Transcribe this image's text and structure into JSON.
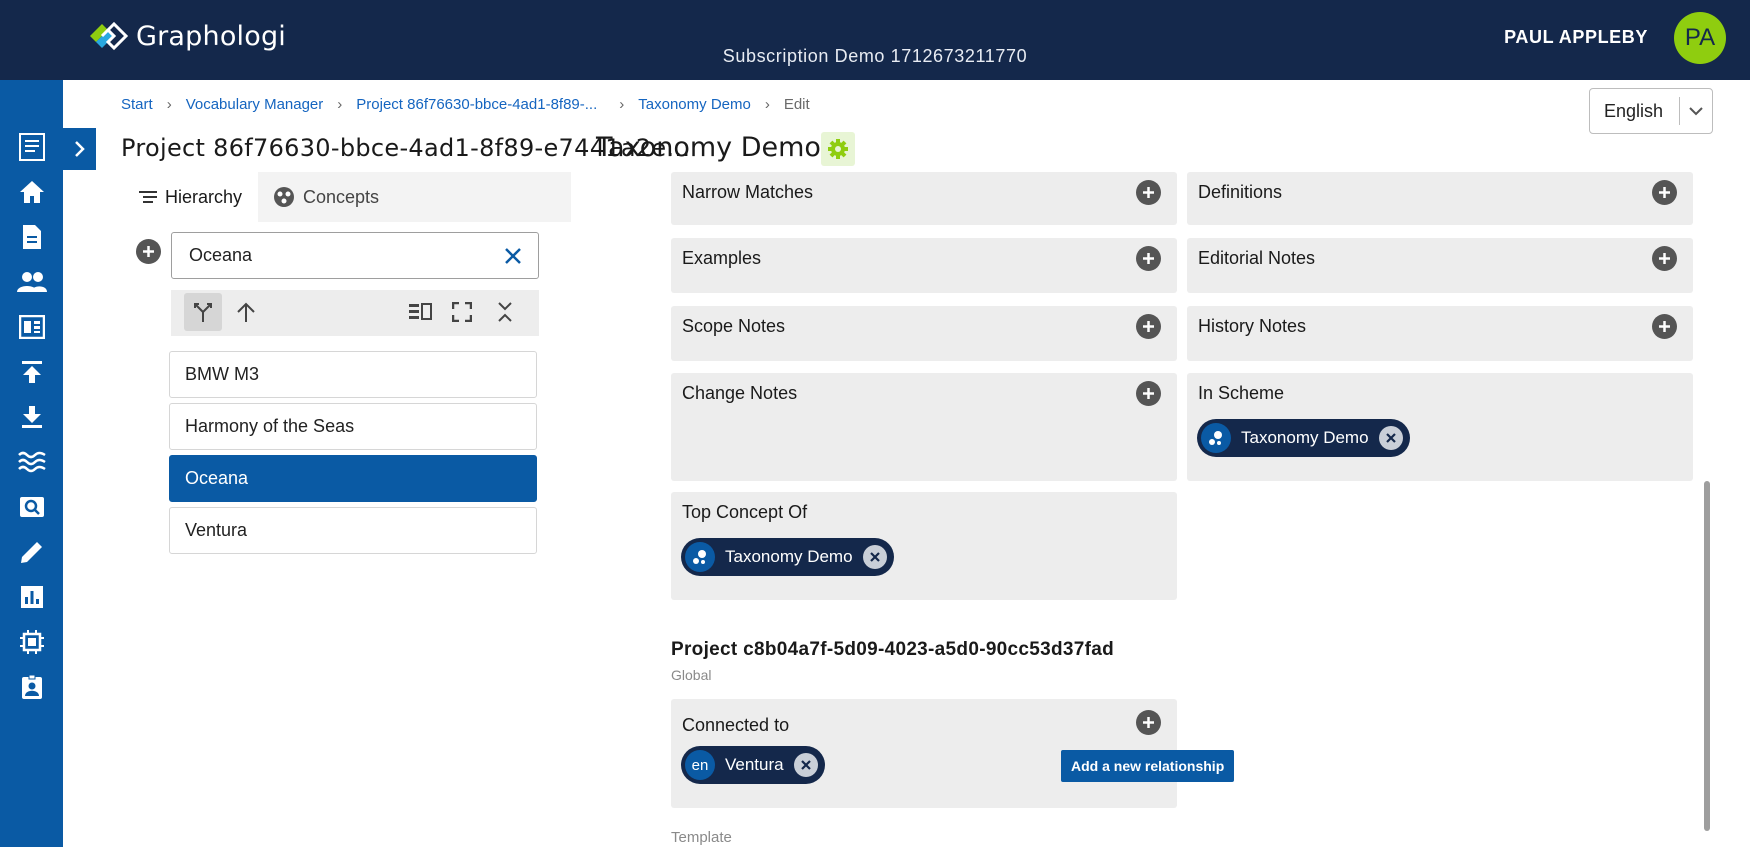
{
  "app": {
    "name": "Graphologi",
    "subscription": "Subscription Demo 1712673211770",
    "user_name": "PAUL APPLEBY",
    "user_initials": "PA"
  },
  "rail": {
    "icons": [
      "document-icon",
      "home-icon",
      "file-icon",
      "people-icon",
      "dashboard-icon",
      "upload-icon",
      "download-icon",
      "waves-icon",
      "search-icon",
      "edit-icon",
      "chart-icon",
      "chip-icon",
      "badge-icon"
    ]
  },
  "breadcrumb": {
    "items": [
      "Start",
      "Vocabulary Manager",
      "Project 86f76630-bbce-4ad1-8f89-...",
      "Taxonomy Demo"
    ],
    "current": "Edit"
  },
  "language": {
    "selected": "English"
  },
  "header": {
    "project_title": "Project 86f76630-bbce-4ad1-8f89-e7441a2e...",
    "taxonomy_title": "Taxonomy Demo"
  },
  "left_panel": {
    "tabs": [
      {
        "label": "Hierarchy",
        "icon": "list-icon"
      },
      {
        "label": "Concepts",
        "icon": "concepts-icon"
      }
    ],
    "search_value": "Oceana",
    "tree_items": [
      "BMW M3",
      "Harmony of the Seas",
      "Oceana",
      "Ventura"
    ],
    "selected_item": "Oceana"
  },
  "fields": {
    "narrow_matches": "Narrow Matches",
    "definitions": "Definitions",
    "examples": "Examples",
    "editorial_notes": "Editorial Notes",
    "scope_notes": "Scope Notes",
    "history_notes": "History Notes",
    "change_notes": "Change Notes",
    "in_scheme": "In Scheme",
    "in_scheme_chip": "Taxonomy Demo",
    "top_concept_of": "Top Concept Of",
    "top_concept_chip": "Taxonomy Demo"
  },
  "section": {
    "title": "Project c8b04a7f-5d09-4023-a5d0-90cc53d37fad",
    "subtitle": "Global",
    "connected_to": "Connected to",
    "chip_lang": "en",
    "chip_label": "Ventura",
    "tooltip": "Add a new relationship",
    "template": "Template"
  },
  "colors": {
    "topbar": "#14284b",
    "rail": "#0a5aa4",
    "accent_green": "#8fcd0f",
    "field_bg": "#ededed"
  }
}
